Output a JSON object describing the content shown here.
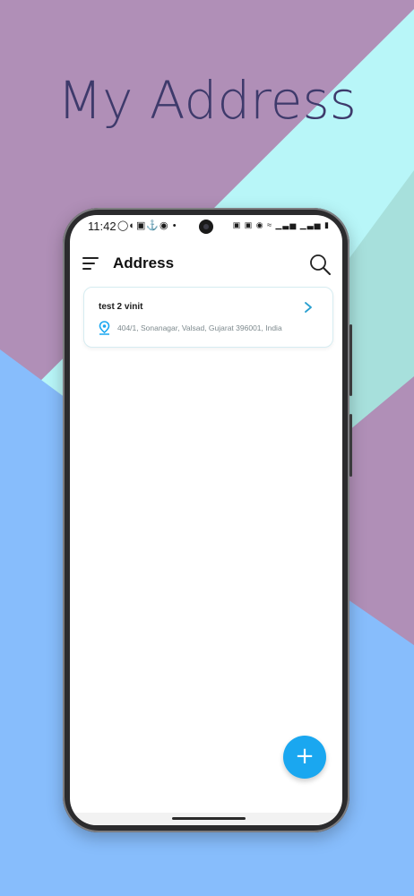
{
  "promo": {
    "title": "My Address"
  },
  "colors": {
    "bg_purple": "#b08fb7",
    "bg_cyan": "#b8f6f8",
    "bg_teal": "#a7e0dc",
    "bg_blue": "#87bdfc",
    "accent": "#1aa7f0"
  },
  "statusbar": {
    "time": "11:42",
    "left_icons": "◯◐▣⚓◉ •",
    "right_icons": "▣ ▣ ◉ ≈ ▁▃▅ ▁▃▅ ▮"
  },
  "appbar": {
    "title": "Address",
    "menu_icon": "menu-icon",
    "search_icon": "search-icon"
  },
  "addresses": [
    {
      "name": "test 2 vinit",
      "address": "404/1, Sonanagar, Valsad, Gujarat 396001, India"
    }
  ],
  "fab": {
    "label": "+"
  }
}
